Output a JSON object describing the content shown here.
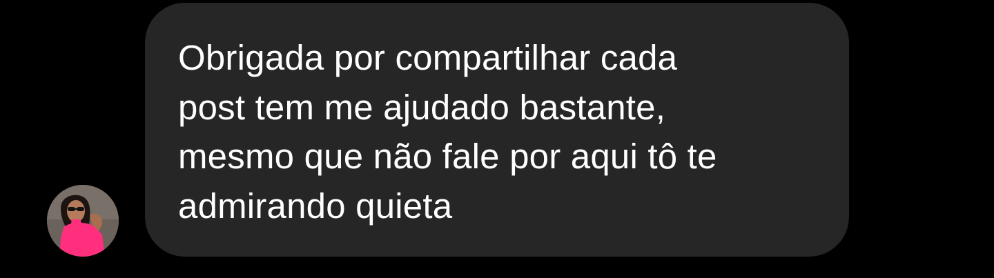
{
  "message": {
    "text": "Obrigada por compartilhar cada\npost tem me ajudado bastante,\nmesmo que não fale por aqui tô te\nadmirando quieta"
  },
  "colors": {
    "background": "#000000",
    "bubble": "#262626",
    "text": "#ffffff"
  }
}
